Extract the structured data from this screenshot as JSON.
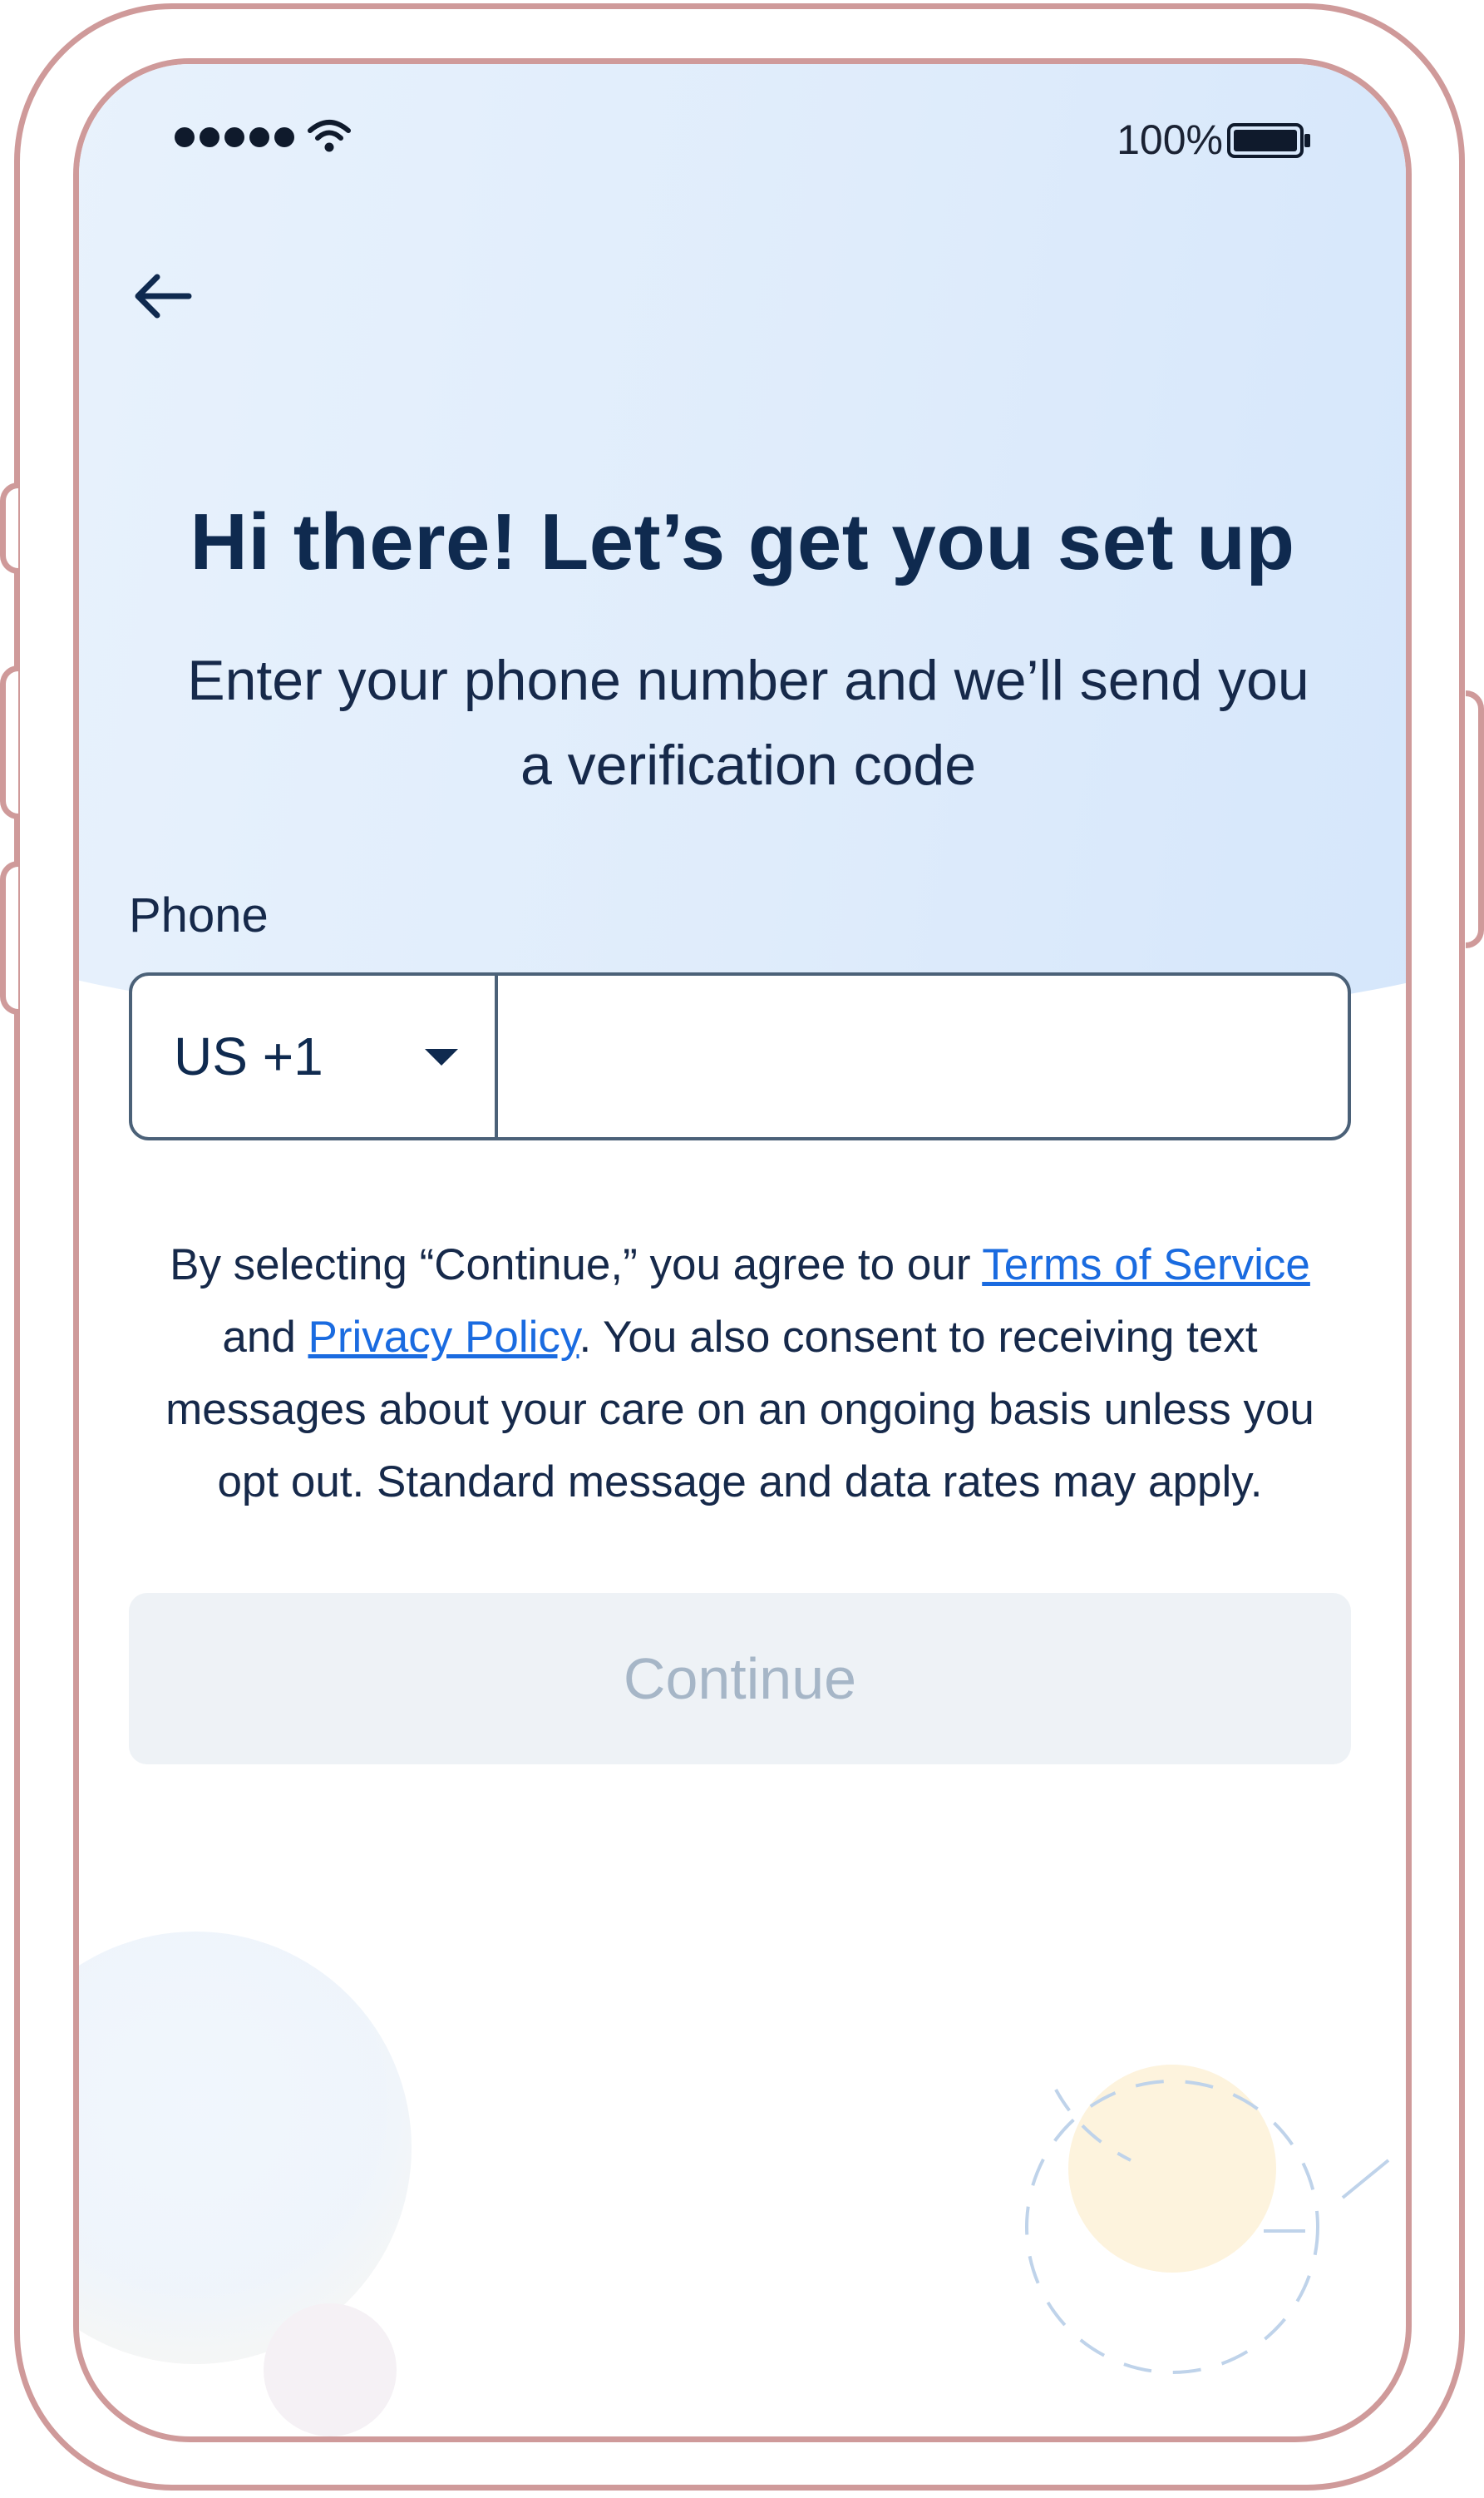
{
  "status_bar": {
    "battery_text": "100%",
    "signal-icon": "signal-dots-icon",
    "wifi-icon": "wifi-icon",
    "battery-icon": "battery-full-icon"
  },
  "navigation": {
    "back_icon": "arrow-left-icon"
  },
  "header": {
    "title": "Hi there! Let’s get you set up",
    "subtitle": "Enter your phone number and we’ll send you a verification code"
  },
  "phone_form": {
    "label": "Phone",
    "country_code": "US +1",
    "phone_value": "",
    "phone_placeholder": ""
  },
  "legal": {
    "part1": "By selecting “Continue,” you agree to our ",
    "terms_link": "Terms of Service",
    "part2": " and ",
    "privacy_link": "Privacy Policy",
    "part3": ". You also consent to receiving text messages about your care on an ongoing basis unless you opt out. Standard message and data rates may apply."
  },
  "actions": {
    "continue_label": "Continue"
  },
  "colors": {
    "primary_text": "#0f2a4f",
    "link": "#1a6be0",
    "disabled_button_bg": "#eef2f6",
    "disabled_button_text": "#a6b6c7",
    "frame": "#cf9a9a"
  }
}
